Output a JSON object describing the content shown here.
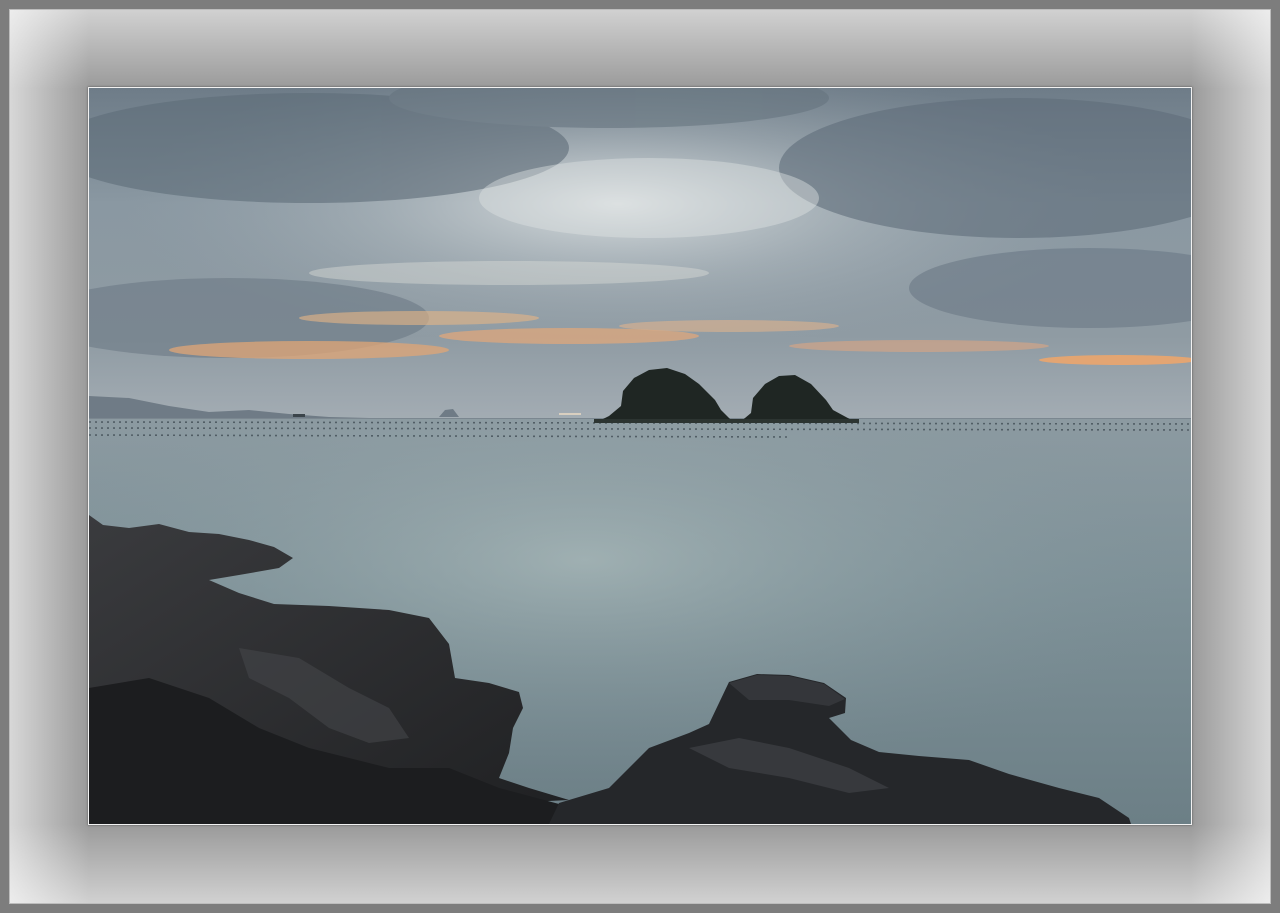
{
  "image": {
    "subject": "seascape-at-dusk",
    "elements": [
      "cloudy-sky",
      "sunset-glow",
      "twin-islets",
      "distant-hills",
      "calm-sea",
      "aquaculture-buoys",
      "foreground-rocks"
    ]
  },
  "colors": {
    "outer_frame": "#7d7d7d",
    "mat": "#9a9a9a",
    "photo_border": "#f2f2f2",
    "sky_top": "#6f7d89",
    "sky_horizon": "#9aa7b2",
    "glow": "#e6a878",
    "sea": "#7f939a",
    "rock": "#2a2a2c"
  }
}
